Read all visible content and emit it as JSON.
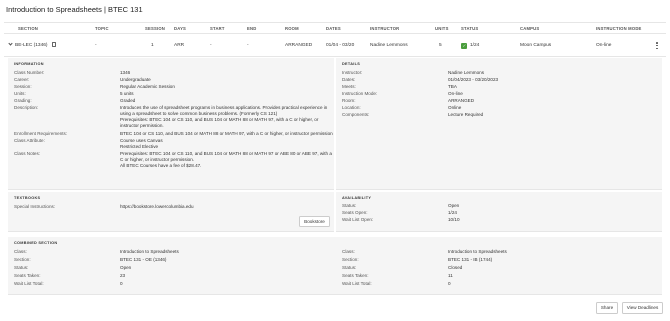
{
  "page_title": "Introduction to Spreadsheets | BTEC 131",
  "columns": [
    "SECTION",
    "TOPIC",
    "SESSION",
    "DAYS",
    "START",
    "END",
    "ROOM",
    "DATES",
    "INSTRUCTOR",
    "UNITS",
    "STATUS",
    "CAMPUS",
    "INSTRUCTION MODE"
  ],
  "section_row": {
    "section": "BE-LEC (1346)",
    "topic": "-",
    "session": "1",
    "days": "ARR",
    "start": "-",
    "end": "-",
    "room": "ARRANGED",
    "dates": "01/04 - 03/20",
    "instructor": "Nadine Lemmons",
    "units": "5",
    "status": "1/24",
    "campus": "Moon Campus",
    "mode": "On-line"
  },
  "information": {
    "title": "INFORMATION",
    "fields": [
      {
        "label": "Class Number:",
        "value": "1346"
      },
      {
        "label": "Career:",
        "value": "Undergraduate"
      },
      {
        "label": "Session:",
        "value": "Regular Academic Session"
      },
      {
        "label": "Units:",
        "value": "5 units"
      },
      {
        "label": "Grading:",
        "value": "Graded"
      }
    ],
    "description_label": "Description:",
    "description_lines": [
      "Introduces the use of spreadsheet programs in business applications. Provides practical experience in",
      "using a spreadsheet to solve common business problems. (Formerly CS 121)",
      "Prerequisites: BTEC 104 or CS 110, and BUS 104 or MATH 88 or MATH 97, with a C or higher, or",
      "instructor permission."
    ],
    "enroll_label": "Enrollment Requirements:",
    "enroll_value": "BTEC 104 or CS 110, and BUS 104 or MATH 88 or MATH 97, with a C or higher, or instructor permission",
    "attr_label": "Class Attribute:",
    "attr_lines": [
      "Course uses Canvas",
      "Restricted Elective"
    ],
    "notes_label": "Class Notes:",
    "notes_lines": [
      "Prerequisites: BTEC 104 or CS 110, and BUS 104 or MATH 88 or MATH 97 or ABE 80 or ABE 97, with a",
      "C or higher, or instructor permission.",
      "All BTEC Courses have a fee of $28.47."
    ]
  },
  "details": {
    "title": "DETAILS",
    "fields": [
      {
        "label": "Instructor:",
        "value": "Nadine Lemmons"
      },
      {
        "label": "Dates:",
        "value": "01/04/2023 - 03/20/2023"
      },
      {
        "label": "Meets:",
        "value": "TBA"
      },
      {
        "label": "Instruction Mode:",
        "value": "On-line"
      },
      {
        "label": "Room:",
        "value": "ARRANGED"
      },
      {
        "label": "Location:",
        "value": "Online"
      },
      {
        "label": "Components:",
        "value": "Lecture Required"
      }
    ]
  },
  "textbooks": {
    "title": "TEXTBOOKS",
    "label": "Special Instructions:",
    "value": "https://bookstore.lowercolumbia.edu",
    "button": "Bookstore"
  },
  "availability": {
    "title": "AVAILABILITY",
    "fields": [
      {
        "label": "Status:",
        "value": "Open"
      },
      {
        "label": "Seats Open:",
        "value": "1/24"
      },
      {
        "label": "Wait List Open:",
        "value": "10/10"
      }
    ]
  },
  "combined": {
    "title": "COMBINED SECTION",
    "left": [
      {
        "label": "Class:",
        "value": "Introduction to Spreadsheets"
      },
      {
        "label": "Section:",
        "value": "BTEC 131 - OE (1346)"
      },
      {
        "label": "Status:",
        "value": "Open"
      },
      {
        "label": "Seats Taken:",
        "value": "23"
      },
      {
        "label": "Wait List Total:",
        "value": "0"
      }
    ],
    "right": [
      {
        "label": "Class:",
        "value": "Introduction to Spreadsheets"
      },
      {
        "label": "Section:",
        "value": "BTEC 131 - IB (1744)"
      },
      {
        "label": "Status:",
        "value": "Closed"
      },
      {
        "label": "Seats Taken:",
        "value": "11"
      },
      {
        "label": "Wait List Total:",
        "value": "0"
      }
    ]
  },
  "footer": {
    "share": "Share",
    "deadlines": "View Deadlines"
  },
  "colors": {
    "status_open": "#4a9d3c",
    "panel_bg": "#f5f5f5"
  }
}
